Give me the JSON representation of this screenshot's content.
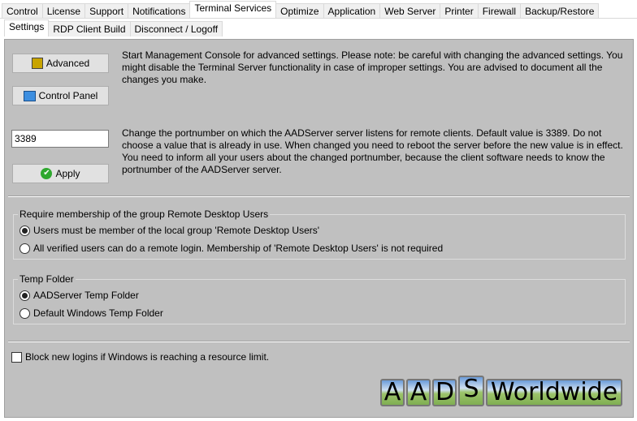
{
  "tabs": [
    "Control",
    "License",
    "Support",
    "Notifications",
    "Terminal Services",
    "Optimize",
    "Application",
    "Web Server",
    "Printer",
    "Firewall",
    "Backup/Restore"
  ],
  "active_tab": "Terminal Services",
  "subtabs": [
    "Settings",
    "RDP Client Build",
    "Disconnect / Logoff"
  ],
  "active_subtab": "Settings",
  "advanced": {
    "label": "Advanced",
    "description": "Start Management Console for advanced settings. Please note: be careful with changing the advanced settings. You might disable the Terminal Server functionality in case of improper settings. You are advised to document all the changes you make."
  },
  "control_panel": {
    "label": "Control Panel"
  },
  "port": {
    "value": "3389",
    "description": "Change the portnumber on which the AADServer server listens for remote clients. Default value is 3389. Do not choose a value that is already in use. When changed you need to reboot the server before the new value is in effect. You need to inform all your users about the changed portnumber, because the client software needs to know the portnumber of the AADServer server.",
    "apply_label": "Apply"
  },
  "membership": {
    "title": "Require membership of the group Remote Desktop Users",
    "options": [
      "Users must be member of the local group 'Remote Desktop Users'",
      "All verified users can do a remote login. Membership of 'Remote Desktop Users' is not required"
    ],
    "selected": 0
  },
  "temp_folder": {
    "title": "Temp Folder",
    "options": [
      "AADServer Temp Folder",
      "Default Windows Temp Folder"
    ],
    "selected": 0
  },
  "block_logins": {
    "label": "Block new logins if Windows is reaching a resource limit.",
    "checked": false
  },
  "logo": [
    "A",
    "A",
    "D",
    "S",
    "Worldwide"
  ]
}
